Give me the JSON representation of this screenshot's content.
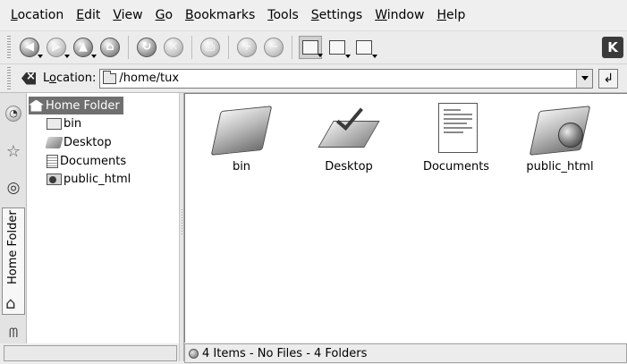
{
  "menubar": {
    "items": [
      {
        "accel": "L",
        "rest": "ocation"
      },
      {
        "accel": "E",
        "rest": "dit"
      },
      {
        "accel": "V",
        "rest": "iew"
      },
      {
        "accel": "G",
        "rest": "o"
      },
      {
        "accel": "B",
        "rest": "ookmarks"
      },
      {
        "accel": "T",
        "rest": "ools"
      },
      {
        "accel": "S",
        "rest": "ettings"
      },
      {
        "accel": "W",
        "rest": "indow"
      },
      {
        "accel": "H",
        "rest": "elp"
      }
    ]
  },
  "toolbar": {
    "buttons": [
      {
        "name": "back-icon",
        "glyph": "◀"
      },
      {
        "name": "forward-icon",
        "glyph": "▶"
      },
      {
        "name": "up-icon",
        "glyph": "▲"
      },
      {
        "name": "home-icon",
        "glyph": "⌂"
      },
      {
        "name": "reload-icon",
        "glyph": "↻"
      },
      {
        "name": "stop-icon",
        "glyph": "✕"
      },
      {
        "name": "print-icon",
        "glyph": "⎙"
      },
      {
        "name": "zoom-in-icon",
        "glyph": "+"
      },
      {
        "name": "zoom-out-icon",
        "glyph": "−"
      },
      {
        "name": "icon-view-icon"
      },
      {
        "name": "detail-view-icon"
      },
      {
        "name": "preview-icon"
      },
      {
        "name": "kde-logo-icon",
        "glyph": "K"
      }
    ]
  },
  "location": {
    "label_accel": "o",
    "label_pre": "L",
    "label_post": "cation:",
    "value": "/home/tux",
    "go_glyph": "↲"
  },
  "sidebar": {
    "tabs": [
      {
        "name": "history-tab-icon",
        "glyph": "◔"
      },
      {
        "name": "bookmarks-tab-icon",
        "glyph": "☆"
      },
      {
        "name": "services-tab-icon",
        "glyph": "◎"
      },
      {
        "name": "network-tab-icon",
        "glyph": "ᗰ"
      }
    ],
    "active_tab": "Home Folder",
    "home_glyph": "⌂"
  },
  "tree": {
    "root": "Home Folder",
    "children": [
      "bin",
      "Desktop",
      "Documents",
      "public_html"
    ]
  },
  "files": [
    {
      "name": "bin",
      "kind": "folder"
    },
    {
      "name": "Desktop",
      "kind": "desktop"
    },
    {
      "name": "Documents",
      "kind": "document"
    },
    {
      "name": "public_html",
      "kind": "web-folder"
    }
  ],
  "status": {
    "text": "4 Items - No Files - 4 Folders"
  }
}
